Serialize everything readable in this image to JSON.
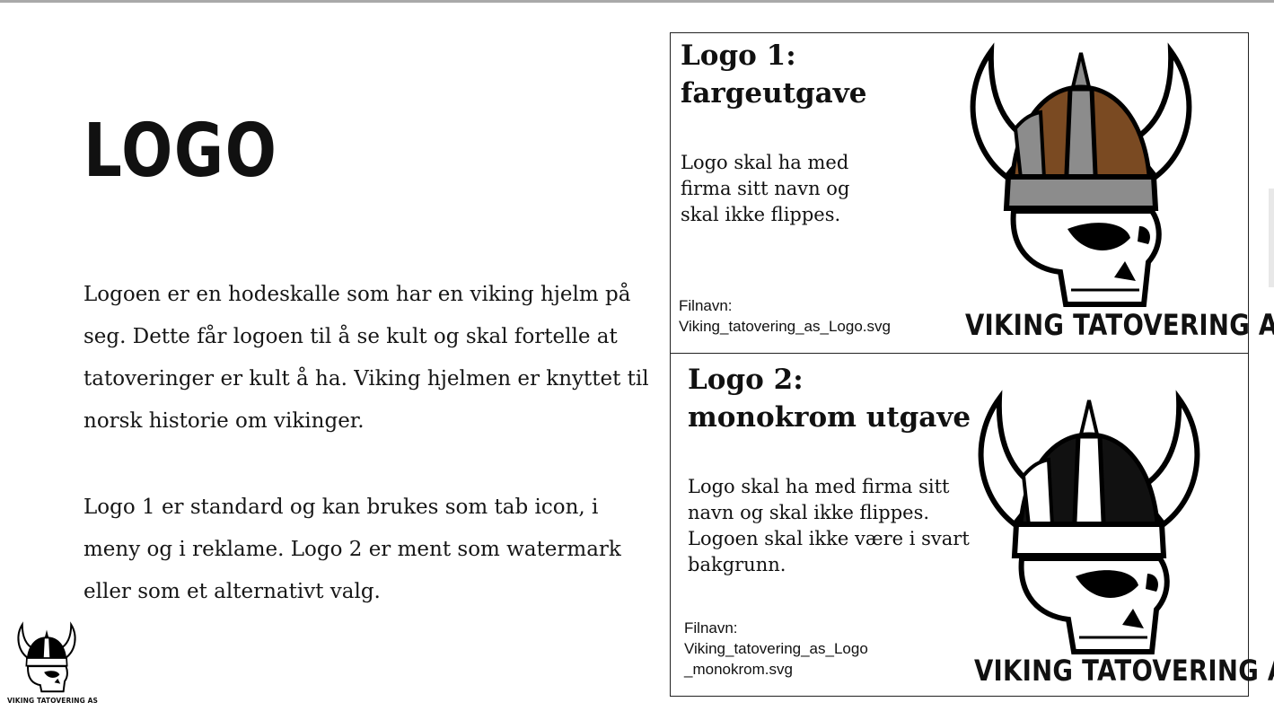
{
  "page": {
    "heading": "LOGO",
    "paragraph_1": "Logoen er en hodeskalle som har en viking hjelm på seg. Dette får logoen til å se kult og skal fortelle at tatoveringer er kult å ha. Viking hjelmen er knyttet til norsk historie om vikinger.",
    "paragraph_2": "Logo 1 er standard og kan brukes som tab icon, i meny og i reklame. Logo 2 er ment som watermark eller som et alternativt valg."
  },
  "brand": {
    "name": "VIKING TATOVERING AS"
  },
  "logos": [
    {
      "title": "Logo 1: fargeutgave",
      "description": "Logo skal ha med firma sitt navn og skal ikke flippes.",
      "file_label": "Filnavn:",
      "file_name": "Viking_tatovering_as_Logo.svg",
      "helmet_color": "#7a4a22",
      "band_color": "#8c8c8c"
    },
    {
      "title": "Logo 2: monokrom utgave",
      "description": "Logo skal ha med firma sitt navn og skal ikke flippes. Logoen skal ikke være i svart bakgrunn.",
      "file_label": "Filnavn:",
      "file_name": "Viking_tatovering_as_Logo _monokrom.svg",
      "helmet_color": "#111111",
      "band_color": "#ffffff"
    }
  ]
}
